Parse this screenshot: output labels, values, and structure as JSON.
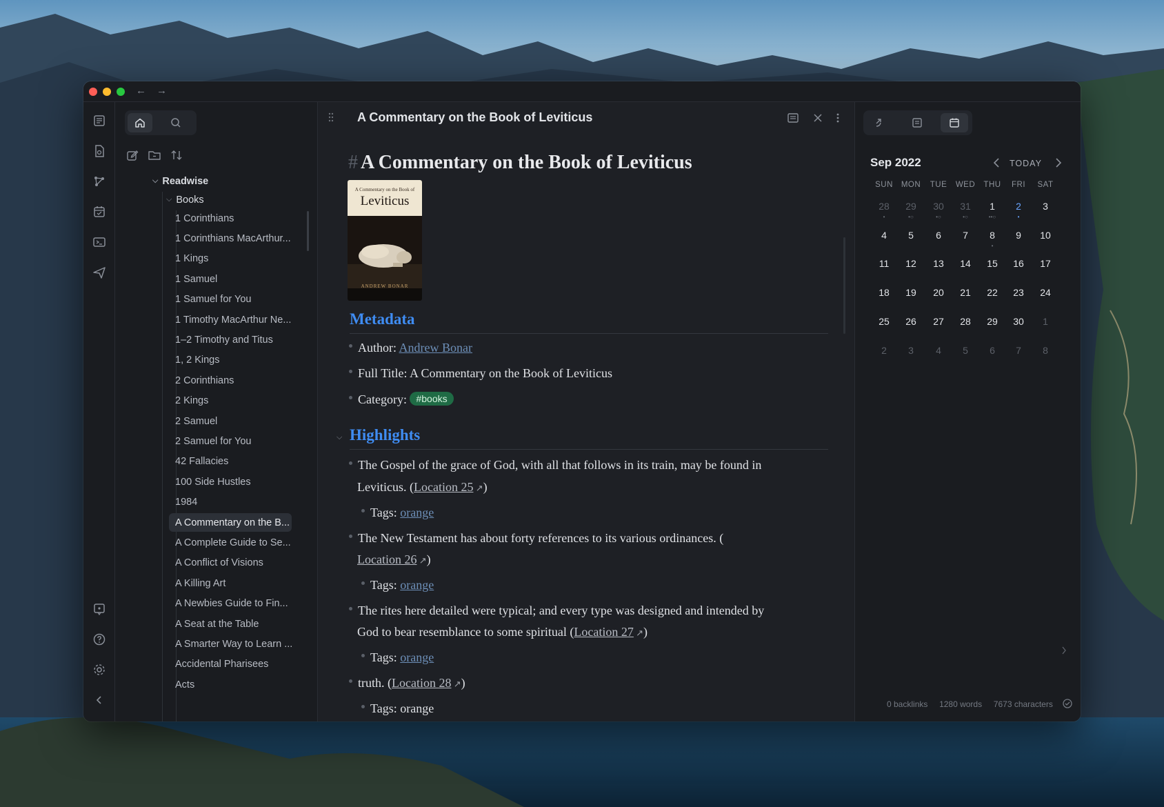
{
  "window": {
    "nav": {
      "back": "←",
      "forward": "→"
    }
  },
  "ribbon": {
    "icons": [
      "pages-icon",
      "document-icon",
      "graph-icon",
      "calendar-icon",
      "terminal-icon",
      "send-icon",
      "help-feedback-icon",
      "help-icon",
      "settings-icon",
      "collapse-icon"
    ]
  },
  "sidebar": {
    "tree": {
      "root": "Readwise",
      "folder": "Books",
      "items": [
        "1 Corinthians",
        "1 Corinthians MacArthur...",
        "1 Kings",
        "1 Samuel",
        "1 Samuel for You",
        "1 Timothy MacArthur Ne...",
        "1–2 Timothy and Titus",
        "1, 2 Kings",
        "2 Corinthians",
        "2 Kings",
        "2 Samuel",
        "2 Samuel for You",
        "42 Fallacies",
        "100 Side Hustles",
        "1984",
        "A Commentary on the B...",
        "A Complete Guide to Se...",
        "A Conflict of Visions",
        "A Killing Art",
        "A Newbies Guide to Fin...",
        "A Seat at the Table",
        "A Smarter Way to Learn ...",
        "Accidental Pharisees",
        "Acts"
      ],
      "active_index": 15
    }
  },
  "main": {
    "tab_title": "A Commentary on the Book of Leviticus",
    "doc": {
      "hash": "#",
      "title": "A Commentary on the Book of Leviticus",
      "cover": {
        "top_line": "A Commentary on the Book of",
        "title": "Leviticus",
        "author": "ANDREW BONAR"
      },
      "metadata_heading": "Metadata",
      "author_label": "Author: ",
      "author_value": "Andrew Bonar",
      "fulltitle_text": "Full Title: A Commentary on the Book of Leviticus",
      "category_label": "Category: ",
      "category_tag": "#books",
      "highlights_heading": "Highlights",
      "highlights": [
        {
          "line1": "The Gospel of the grace of God, with all that follows in its train, may be found in",
          "line2_pre": "Leviticus. (",
          "location": "Location 25",
          "line2_post": ")",
          "tags_label": "Tags: ",
          "tag": "orange"
        },
        {
          "line1": "The New Testament has about forty references to its various ordinances. (",
          "line2_pre": "",
          "location": "Location 26",
          "line2_post": ")",
          "tags_label": "Tags: ",
          "tag": "orange"
        },
        {
          "line1": "The rites here detailed were typical; and every type was designed and intended by",
          "line2_pre": "God to bear resemblance to some spiritual (",
          "location": "Location 27",
          "line2_post": ")",
          "tags_label": "Tags: ",
          "tag": "orange"
        },
        {
          "line1_pre": "truth. (",
          "location": "Location 28",
          "line1_post": ")"
        }
      ],
      "partial_text": "Tags: orange"
    }
  },
  "calendar": {
    "month": "Sep 2022",
    "today_label": "TODAY",
    "dow": [
      "SUN",
      "MON",
      "TUE",
      "WED",
      "THU",
      "FRI",
      "SAT"
    ],
    "weeks": [
      [
        "28",
        "29",
        "30",
        "31",
        "1",
        "2",
        "3"
      ],
      [
        "4",
        "5",
        "6",
        "7",
        "8",
        "9",
        "10"
      ],
      [
        "11",
        "12",
        "13",
        "14",
        "15",
        "16",
        "17"
      ],
      [
        "18",
        "19",
        "20",
        "21",
        "22",
        "23",
        "24"
      ],
      [
        "25",
        "26",
        "27",
        "28",
        "29",
        "30",
        "1"
      ],
      [
        "2",
        "3",
        "4",
        "5",
        "6",
        "7",
        "8"
      ]
    ],
    "today": "2"
  },
  "status": {
    "backlinks": "0 backlinks",
    "words": "1280 words",
    "characters": "7673 characters"
  },
  "colors": {
    "accent": "#3f8cf2",
    "tag_bg": "#1f6b45",
    "link": "#6d8fb8",
    "today": "#6aa5ff"
  }
}
